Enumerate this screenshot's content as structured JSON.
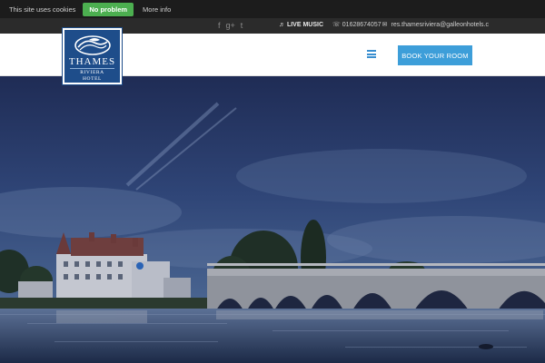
{
  "cookie_bar": {
    "message": "This site uses cookies",
    "accept_label": "No problem",
    "more_label": "More info"
  },
  "top_bar": {
    "social_icons": [
      "facebook-icon",
      "google-plus-icon",
      "twitter-icon"
    ],
    "social_glyphs": {
      "facebook": "f",
      "google_plus": "g+",
      "twitter": "t"
    },
    "music_label": "♬ LIVE MUSIC",
    "phone": "01628674057",
    "email": "res.thamesriviera@galleonhotels.c"
  },
  "header": {
    "logo": {
      "name": "THAMES",
      "subtitle": "RIVIERA HOTEL"
    },
    "book_label": "BOOK YOUR ROOM"
  },
  "colors": {
    "accent_blue": "#3d9ed9",
    "cookie_green": "#4caf50",
    "logo_blue": "#1e4d8a",
    "top_bar": "#2b2b2b"
  }
}
